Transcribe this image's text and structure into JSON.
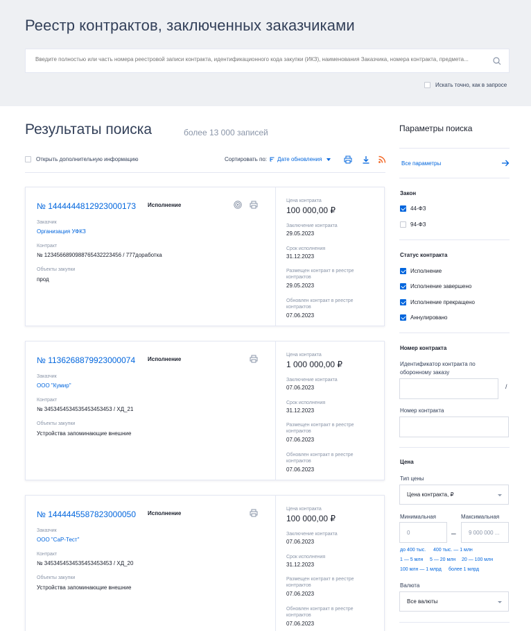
{
  "header": {
    "title": "Реестр контрактов, заключенных заказчиками",
    "search_placeholder": "Введите полностью или часть номера реестровой записи контракта, идентификационного кода закупки (ИКЗ), наименования Заказчика, номера контракта, предмета...",
    "exact_match_label": "Искать точно, как в запросе"
  },
  "results": {
    "title": "Результаты поиска",
    "count": "более 13 000 записей",
    "open_info_label": "Открыть дополнительную информацию",
    "sort_label": "Сортировать по:",
    "sort_value": "Дате обновления"
  },
  "labels": {
    "customer": "Заказчик",
    "contract": "Контракт",
    "objects": "Объекты закупки",
    "price": "Цена контракта",
    "concluded": "Заключение контракта",
    "term": "Срок исполнения",
    "placed": "Размещен контракт в реестре контрактов",
    "updated": "Обновлен контракт в реестре контрактов"
  },
  "cards": [
    {
      "number": "№ 1444444812923000173",
      "status": "Исполнение",
      "customer": "Организация УФКЗ",
      "contract": "№ 1234566890988765432223456 / 777доработка",
      "objects": "прод",
      "price": "100 000,00 ₽",
      "concluded": "29.05.2023",
      "term": "31.12.2023",
      "placed": "29.05.2023",
      "updated": "07.06.2023"
    },
    {
      "number": "№ 1136268879923000074",
      "status": "Исполнение",
      "customer": "ООО \"Кумир\"",
      "contract": "№ 3453454534535453453453 / ХД_21",
      "objects": "Устройства запоминающие внешние",
      "price": "1 000 000,00 ₽",
      "concluded": "07.06.2023",
      "term": "31.12.2023",
      "placed": "07.06.2023",
      "updated": "07.06.2023"
    },
    {
      "number": "№ 1444445587823000050",
      "status": "Исполнение",
      "customer": "ООО \"СаР-Тест\"",
      "contract": "№ 3453454534535453453453 / ХД_20",
      "objects": "Устройства запоминающие внешние",
      "price": "100 000,00 ₽",
      "concluded": "07.06.2023",
      "term": "31.12.2023",
      "placed": "07.06.2023",
      "updated": "07.06.2023"
    }
  ],
  "params": {
    "title": "Параметры поиска",
    "all_params": "Все параметры",
    "law": {
      "title": "Закон",
      "options": [
        {
          "label": "44-ФЗ",
          "checked": true
        },
        {
          "label": "94-ФЗ",
          "checked": false
        }
      ]
    },
    "status": {
      "title": "Статус контракта",
      "options": [
        {
          "label": "Исполнение",
          "checked": true
        },
        {
          "label": "Исполнение завершено",
          "checked": true
        },
        {
          "label": "Исполнение прекращено",
          "checked": true
        },
        {
          "label": "Аннулировано",
          "checked": true
        }
      ]
    },
    "contract_number": {
      "title": "Номер контракта",
      "defense_label": "Идентификатор контракта по оборонному заказу",
      "number_label": "Номер контракта"
    },
    "price": {
      "title": "Цена",
      "type_label": "Тип цены",
      "type_value": "Цена контракта, ₽",
      "min_label": "Минимальная",
      "max_label": "Максимальная",
      "min_placeholder": "0",
      "max_placeholder": "9 000 000 ...",
      "ranges": [
        "до 400 тыс.",
        "400 тыс. — 1 млн",
        "1 — 5 млн",
        "5 — 20 млн",
        "20 — 100 млн",
        "100 млн — 1 млрд",
        "более 1 млрд"
      ],
      "currency_label": "Валюта",
      "currency_value": "Все валюты"
    }
  },
  "colors": {
    "accent": "#0065dd",
    "rss": "#f26522",
    "header_bg": "#eef0f3"
  }
}
